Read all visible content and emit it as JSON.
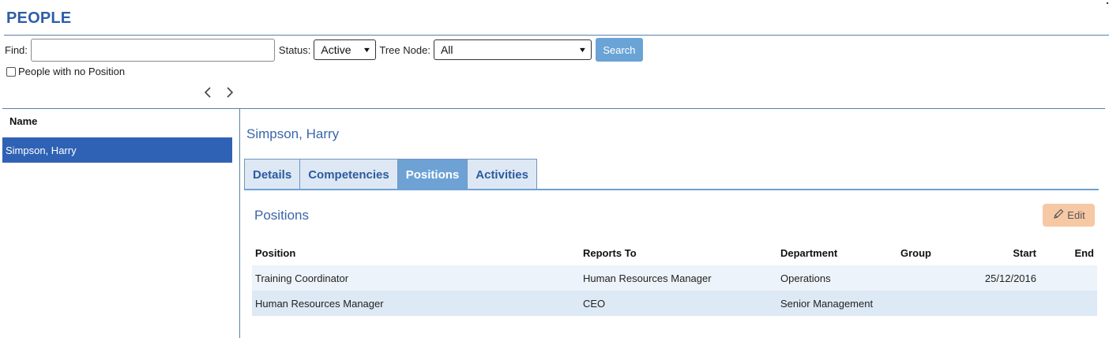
{
  "page": {
    "title": "PEOPLE"
  },
  "search": {
    "find_label": "Find:",
    "find_value": "",
    "find_placeholder": "",
    "status_label": "Status:",
    "status_value": "Active",
    "tree_label": "Tree Node:",
    "tree_value": "All",
    "search_button": "Search",
    "no_position_label": "People with no Position",
    "no_position_checked": false
  },
  "list": {
    "header": "Name",
    "items": [
      {
        "label": "Simpson, Harry",
        "selected": true
      }
    ]
  },
  "detail": {
    "person_name": "Simpson, Harry",
    "tabs": [
      {
        "label": "Details",
        "active": false
      },
      {
        "label": "Competencies",
        "active": false
      },
      {
        "label": "Positions",
        "active": true
      },
      {
        "label": "Activities",
        "active": false
      }
    ],
    "section_title": "Positions",
    "edit_label": "Edit",
    "table": {
      "headers": [
        "Position",
        "Reports To",
        "Department",
        "Group",
        "Start",
        "End"
      ],
      "rows": [
        [
          "Training Coordinator",
          "Human Resources Manager",
          "Operations",
          "",
          "25/12/2016",
          ""
        ],
        [
          "Human Resources Manager",
          "CEO",
          "Senior Management",
          "",
          "",
          ""
        ]
      ]
    }
  },
  "icons": {
    "prev": "chevron-left-icon",
    "next": "chevron-right-icon",
    "edit": "pencil-icon",
    "dropdown": "chevron-down-icon"
  },
  "colors": {
    "brand": "#2e5ea8",
    "selected_row": "#2f62b5",
    "tab_active": "#6ea2d5",
    "search_button": "#6aa3d6",
    "edit_button": "#f7c8a4"
  }
}
